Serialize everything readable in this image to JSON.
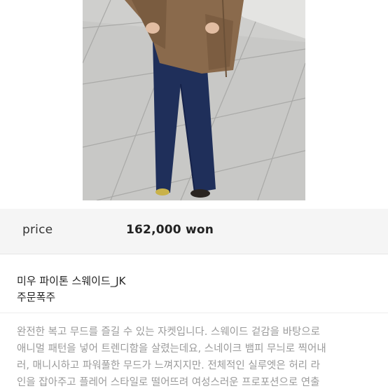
{
  "product": {
    "price_label": "price",
    "price_value": "162,000 won",
    "name": "미우 파이톤 스웨이드_JK",
    "status": "주문폭주",
    "description_lines": [
      "완전한 복고 무드를 즐길 수 있는 자켓입니다. 스웨이드 겉감을 바탕으로",
      "애니멀 패턴을 넣어 트렌디함을 살렸는데요, 스네이크 뱀피 무늬로 찍어내",
      "러, 매니시하고 파워풀한 무드가 느껴지지만. 전체적인 실루엣은 허리 라",
      "인을 잡아주고 플레어 스타일로 떨어뜨려 여성스러운 프로포션으로 연출"
    ]
  },
  "colors": {
    "price_band": "#f5f5f5",
    "description_text": "#9a9a9a",
    "jacket": "#8a6a4c",
    "jeans": "#1f2f5a"
  }
}
